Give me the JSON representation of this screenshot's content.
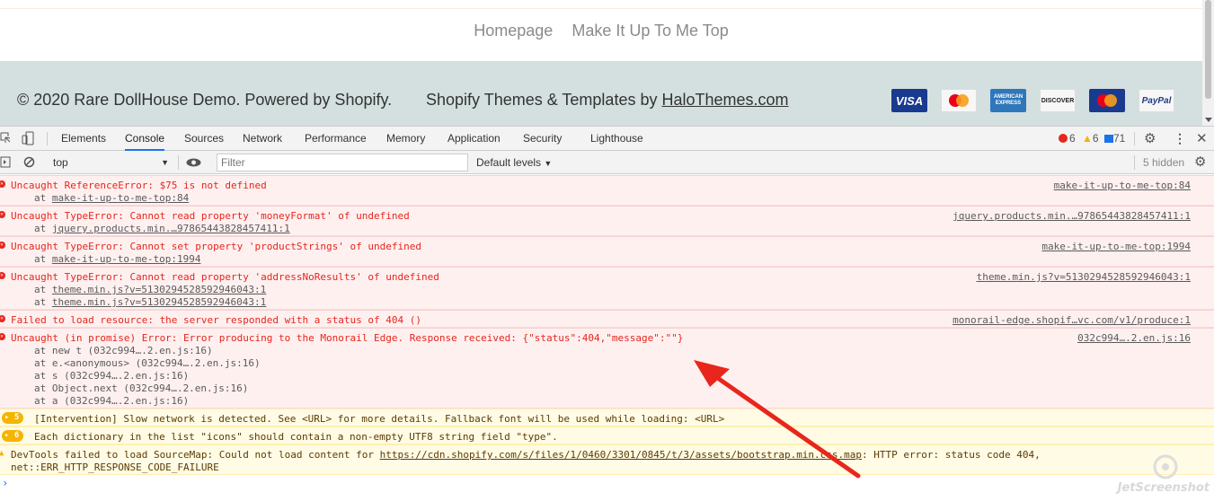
{
  "nav": {
    "links": [
      "Homepage",
      "Make It Up To Me Top"
    ]
  },
  "footer": {
    "copyright": "© 2020 Rare DollHouse Demo. Powered by Shopify.",
    "themes_prefix": "Shopify Themes & Templates by ",
    "themes_link": "HaloThemes.com",
    "payments": [
      "VISA",
      "MasterCard",
      "AMERICAN EXPRESS",
      "DISCOVER",
      "MasterCard",
      "PayPal"
    ]
  },
  "devtools": {
    "tabs": [
      "Elements",
      "Console",
      "Sources",
      "Network",
      "Performance",
      "Memory",
      "Application",
      "Security",
      "Lighthouse"
    ],
    "active_tab": "Console",
    "error_count": "6",
    "warning_count": "6",
    "info_count": "71",
    "context": "top",
    "filter_placeholder": "Filter",
    "levels": "Default levels",
    "hidden": "5 hidden"
  },
  "console": {
    "messages": [
      {
        "text": "Uncaught ReferenceError: $75 is not defined",
        "trace": [
          "at make-it-up-to-me-top:84"
        ],
        "source": "make-it-up-to-me-top:84"
      },
      {
        "text": "Uncaught TypeError: Cannot read property 'moneyFormat' of undefined",
        "trace": [
          "at jquery.products.min.…97865443828457411:1"
        ],
        "source": "jquery.products.min.…97865443828457411:1"
      },
      {
        "text": "Uncaught TypeError: Cannot set property 'productStrings' of undefined",
        "trace": [
          "at make-it-up-to-me-top:1994"
        ],
        "source": "make-it-up-to-me-top:1994"
      },
      {
        "text": "Uncaught TypeError: Cannot read property 'addressNoResults' of undefined",
        "trace": [
          "at theme.min.js?v=5130294528592946043:1",
          "at theme.min.js?v=5130294528592946043:1"
        ],
        "source": "theme.min.js?v=5130294528592946043:1"
      },
      {
        "text": "Failed to load resource: the server responded with a status of 404 ()",
        "trace": [],
        "source": "monorail-edge.shopif…vc.com/v1/produce:1"
      },
      {
        "text": "Uncaught (in promise) Error: Error producing to the Monorail Edge. Response received: {\"status\":404,\"message\":\"\"}",
        "trace": [
          "at new t (032c994….2.en.js:16)",
          "at e.<anonymous> (032c994….2.en.js:16)",
          "at s (032c994….2.en.js:16)",
          "at Object.next (032c994….2.en.js:16)",
          "at a (032c994….2.en.js:16)"
        ],
        "source": "032c994….2.en.js:16"
      }
    ],
    "warnings": [
      {
        "badge": "5",
        "text": "[Intervention] Slow network is detected. See <URL> for more details. Fallback font will be used while loading: <URL>"
      },
      {
        "badge": "6",
        "text": "Each dictionary in the list \"icons\" should contain a non-empty UTF8 string field \"type\"."
      }
    ],
    "devtools_warning": {
      "prefix": "DevTools failed to load SourceMap: Could not load content for ",
      "url": "https://cdn.shopify.com/s/files/1/0460/3301/0845/t/3/assets/bootstrap.min.css.map",
      "suffix": ": HTTP error: status code 404,",
      "line2": "net::ERR_HTTP_RESPONSE_CODE_FAILURE"
    }
  },
  "watermark": "JetScreenshot",
  "colors": {
    "footer_bg": "#d3e0df",
    "error_text": "#e5261c",
    "error_bg": "#fff0f0",
    "warning_bg": "#fffbe5",
    "arrow": "#e8261b",
    "accent": "#1a73e8"
  }
}
